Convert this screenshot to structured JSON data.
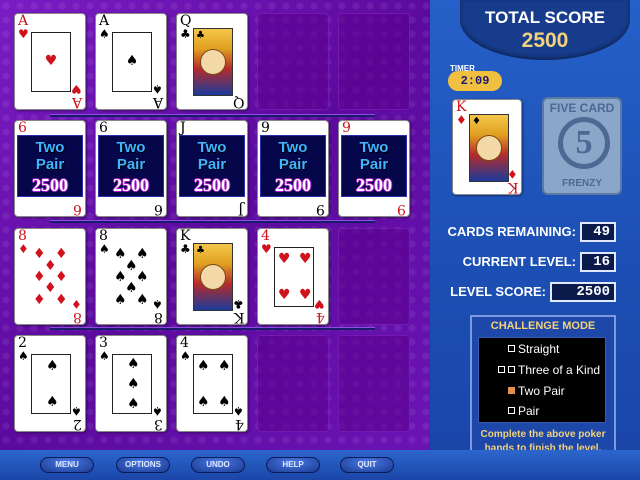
{
  "score": {
    "label": "TOTAL SCORE",
    "value": "2500"
  },
  "timer": {
    "label": "TIMER",
    "value": "2:09"
  },
  "deck": {
    "top": "FIVE CARD",
    "number": "5",
    "bottom": "FRENZY"
  },
  "current_card": {
    "rank": "K",
    "suit": "♦"
  },
  "stats": {
    "cards_remaining_label": "CARDS REMAINING:",
    "cards_remaining": "49",
    "current_level_label": "CURRENT LEVEL:",
    "current_level": "16",
    "level_score_label": "LEVEL SCORE:",
    "level_score": "2500"
  },
  "challenge": {
    "title": "CHALLENGE MODE",
    "items": [
      "Straight",
      "Three of a Kind",
      "Two Pair",
      "Pair"
    ],
    "note": "Complete the above poker hands to finish the level."
  },
  "overlay": {
    "line1": "Two",
    "line2": "Pair",
    "score": "2500"
  },
  "board": {
    "row1": [
      {
        "rank": "A",
        "suit": "♥"
      },
      {
        "rank": "A",
        "suit": "♠"
      },
      {
        "rank": "Q",
        "suit": "♣"
      }
    ],
    "row2": [
      {
        "rank": "6",
        "suit": "♦"
      },
      {
        "rank": "6",
        "suit": "♠"
      },
      {
        "rank": "J",
        "suit": "♦"
      },
      {
        "rank": "9",
        "suit": "♠"
      },
      {
        "rank": "9",
        "suit": "♦"
      }
    ],
    "row3": [
      {
        "rank": "8",
        "suit": "♦"
      },
      {
        "rank": "8",
        "suit": "♠"
      },
      {
        "rank": "K",
        "suit": "♣"
      },
      {
        "rank": "4",
        "suit": "♥"
      }
    ],
    "row4": [
      {
        "rank": "2",
        "suit": "♠"
      },
      {
        "rank": "3",
        "suit": "♠"
      },
      {
        "rank": "4",
        "suit": "♠"
      }
    ]
  },
  "buttons": {
    "menu": "MENU",
    "options": "OPTIONS",
    "undo": "UNDO",
    "help": "HELP",
    "quit": "QUIT"
  },
  "colors": {
    "board": "#6a0fb0",
    "panel": "#1c4fb4",
    "accent": "#f2d27a",
    "red_suit": "#d0121d"
  }
}
